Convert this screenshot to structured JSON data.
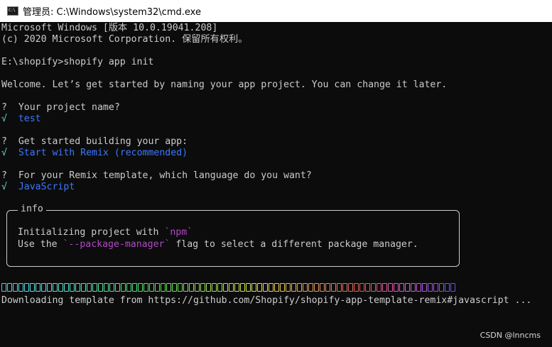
{
  "window": {
    "title": "管理员: C:\\Windows\\system32\\cmd.exe",
    "icon_label": "C:\\"
  },
  "terminal": {
    "banner_line1": "Microsoft Windows [版本 10.0.19041.208]",
    "banner_line2": "(c) 2020 Microsoft Corporation. 保留所有权利。",
    "prompt_line": "E:\\shopify>shopify app init",
    "welcome_line": "Welcome. Let’s get started by naming your app project. You can change it later.",
    "questions": [
      {
        "mark": "?",
        "question": "Your project name?",
        "check": "√",
        "answer": "test"
      },
      {
        "mark": "?",
        "question": "Get started building your app:",
        "check": "√",
        "answer": "Start with Remix (recommended)"
      },
      {
        "mark": "?",
        "question": "For your Remix template, which language do you want?",
        "check": "√",
        "answer": "JavaScript"
      }
    ],
    "info_box": {
      "label": "info",
      "line1_prefix": "Initializing project with ",
      "line1_code": "`npm`",
      "line2_prefix": "Use the ",
      "line2_code": "`--package-manager`",
      "line2_suffix": " flag to select a different package manager."
    },
    "progress": {
      "segments": 80,
      "filled_fraction": 1.0
    },
    "download_line": "Downloading template from https://github.com/Shopify/shopify-app-template-remix#javascript ..."
  },
  "watermark": "CSDN @lnncms",
  "colors": {
    "background": "#0c0c0c",
    "text": "#cccccc",
    "answer_blue": "#3b78ff",
    "check_cyan": "#61d6d6",
    "code_magenta": "#b148c6"
  }
}
